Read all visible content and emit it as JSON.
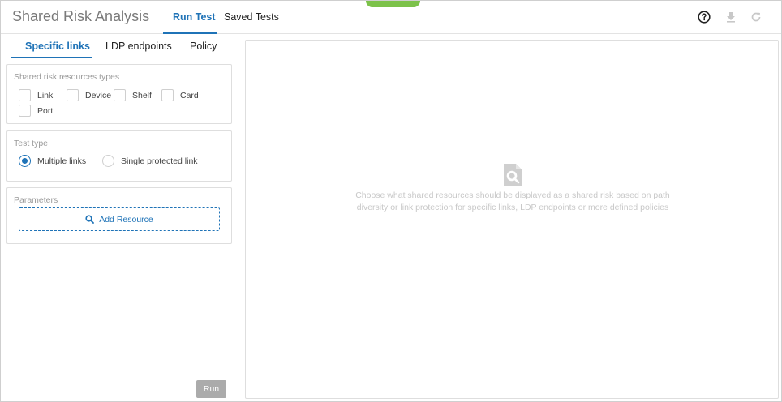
{
  "header": {
    "app_title": "Shared Risk Analysis",
    "nav": [
      {
        "label": "Run Test",
        "active": true
      },
      {
        "label": "Saved Tests",
        "active": false
      }
    ],
    "icons": [
      "help-icon",
      "download-icon",
      "refresh-icon"
    ]
  },
  "left": {
    "tabs": [
      {
        "label": "Specific links",
        "active": true
      },
      {
        "label": "LDP endpoints",
        "active": false
      },
      {
        "label": "Policy",
        "active": false
      }
    ],
    "resources": {
      "title": "Shared risk resources types",
      "options": [
        "Link",
        "Device",
        "Shelf",
        "Card",
        "Port"
      ]
    },
    "test_type": {
      "title": "Test type",
      "options": [
        "Multiple links",
        "Single protected link"
      ],
      "selected": "Multiple links"
    },
    "parameters": {
      "title": "Parameters",
      "add_label": "Add Resource"
    },
    "run_label": "Run"
  },
  "right": {
    "empty_line1": "Choose what shared resources should be displayed as a shared risk based on path",
    "empty_line2": "diversity or link protection for specific links, LDP endpoints or more defined policies"
  },
  "colors": {
    "accent": "#1f73b7",
    "green_tab": "#7cc24a",
    "disabled": "#ababab"
  }
}
